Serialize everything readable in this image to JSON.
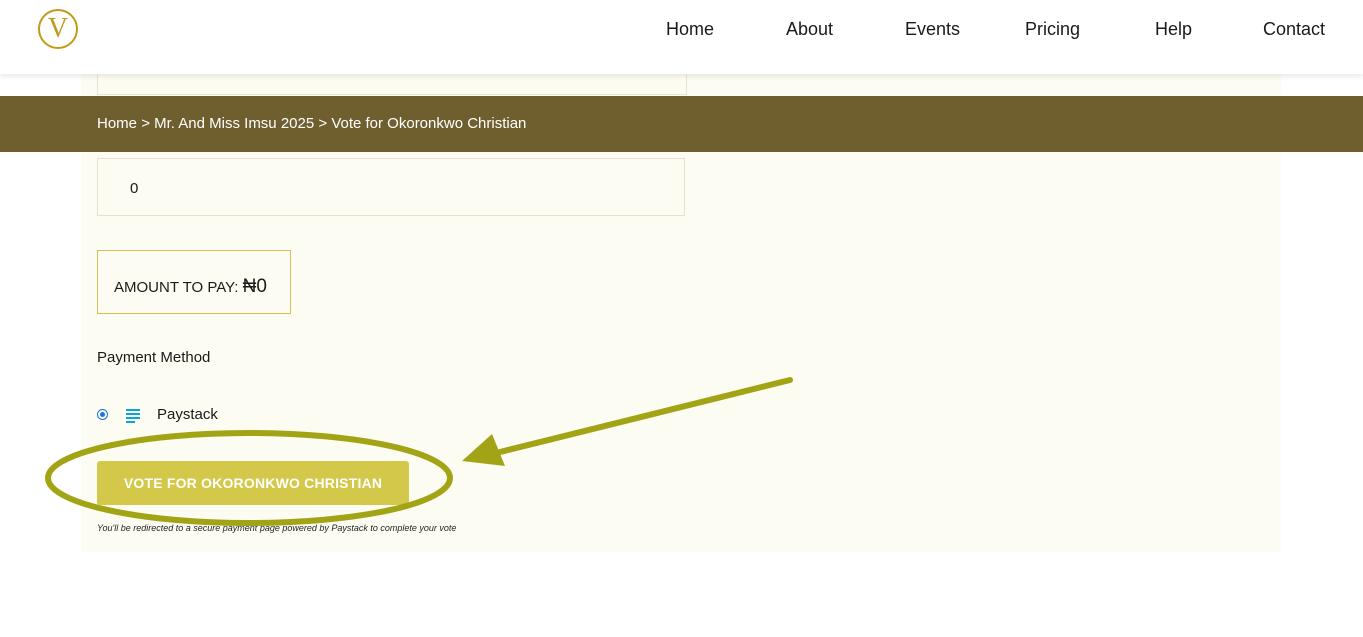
{
  "logo": {
    "letter": "V",
    "color": "#c29a1b"
  },
  "nav": {
    "items": [
      "Home",
      "About",
      "Events",
      "Pricing",
      "Help",
      "Contact"
    ]
  },
  "breadcrumb": {
    "home": "Home",
    "sep1": ">",
    "event": "Mr. And Miss Imsu 2025",
    "sep2": ">",
    "current": "Vote for Okoronkwo Christian"
  },
  "form": {
    "vote_count_value": "0",
    "amount_label": "AMOUNT TO PAY:",
    "amount_value": "₦0",
    "payment_method_label": "Payment Method",
    "payment_option": "Paystack",
    "payment_option_selected": true,
    "vote_button": "VOTE FOR OKORONKWO CHRISTIAN",
    "redirect_note": "You'll be redirected to a secure payment page powered by Paystack to complete your vote"
  },
  "colors": {
    "breadcrumb_bar": "#6f5e2e",
    "vote_button": "#d4c84a",
    "annotation": "#a3a316",
    "content_bg": "#fdfcf3"
  }
}
